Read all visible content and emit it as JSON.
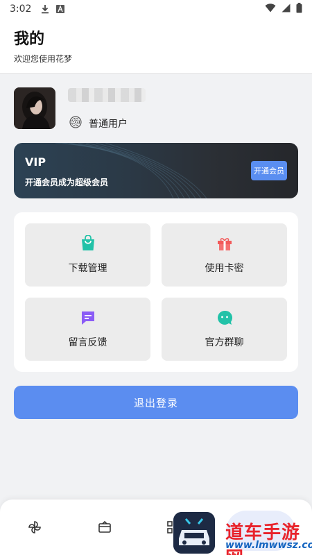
{
  "status_bar": {
    "time": "3:02",
    "icons": [
      "download-icon",
      "text-a-icon",
      "wifi-icon",
      "signal-icon",
      "battery-icon"
    ]
  },
  "header": {
    "title": "我的",
    "subtitle": "欢迎您使用花梦"
  },
  "profile": {
    "username": "",
    "level_label": "普通用户",
    "level_icon": "fingerprint-icon"
  },
  "vip": {
    "title": "VIP",
    "description": "开通会员成为超级会员",
    "button_label": "开通会员"
  },
  "features": [
    {
      "label": "下载管理",
      "icon": "shopping-bag-icon",
      "color": "#22c2a8"
    },
    {
      "label": "使用卡密",
      "icon": "gift-icon",
      "color": "#f25a5a"
    },
    {
      "label": "留言反馈",
      "icon": "message-icon",
      "color": "#8b5cf6"
    },
    {
      "label": "官方群聊",
      "icon": "chat-face-icon",
      "color": "#22c2a8"
    }
  ],
  "logout_label": "退出登录",
  "bottom_nav": {
    "items": [
      "pinwheel-icon",
      "ticket-icon",
      "grid-icon"
    ]
  },
  "watermark": {
    "text": "道车手游网",
    "url": "www.lmwwsz.com"
  },
  "colors": {
    "accent": "#5b8df0",
    "background": "#f1f2f4"
  }
}
